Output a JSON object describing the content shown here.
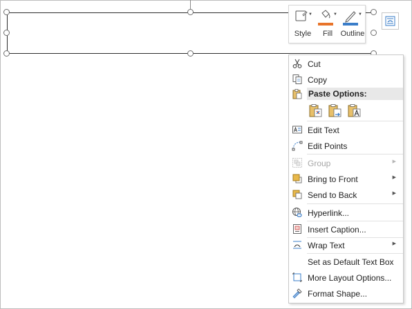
{
  "mini_toolbar": {
    "style_label": "Style",
    "fill_label": "Fill",
    "outline_label": "Outline",
    "fill_color": "#e8742a",
    "outline_color": "#3a7dc9"
  },
  "layout_options_icon": "layout-options-icon",
  "context_menu": {
    "cut": "Cut",
    "copy": "Copy",
    "paste_options_header": "Paste Options:",
    "edit_text": "Edit Text",
    "edit_points": "Edit Points",
    "group": "Group",
    "bring_to_front": "Bring to Front",
    "send_to_back": "Send to Back",
    "hyperlink": "Hyperlink...",
    "insert_caption": "Insert Caption...",
    "wrap_text": "Wrap Text",
    "set_default_text_box": "Set as Default Text Box",
    "more_layout_options": "More Layout Options...",
    "format_shape": "Format Shape..."
  },
  "submenu_arrow": "▶"
}
